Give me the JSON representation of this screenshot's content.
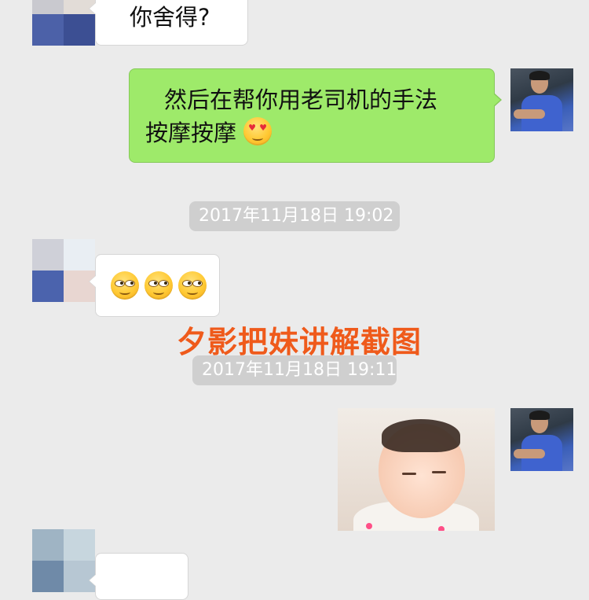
{
  "messages": {
    "m1_text": "你舍得?",
    "m2_text_line1": "然后在帮你用老司机的手法",
    "m2_text_line2": "按摩按摩"
  },
  "timestamps": {
    "t1": "2017年11月18日 19:02",
    "t2": "2017年11月18日 19:11"
  },
  "overlay": {
    "title": "夕影把妹讲解截图"
  },
  "emoji_names": {
    "heart_eyes": "heart-eyes-emoji",
    "smirk": "smirk-emoji"
  },
  "colors": {
    "background": "#ebebeb",
    "bubble_green": "#9eea6a",
    "bubble_white": "#ffffff",
    "timestamp_bg": "#cfcfcf",
    "overlay_title": "#ef5a1b"
  }
}
